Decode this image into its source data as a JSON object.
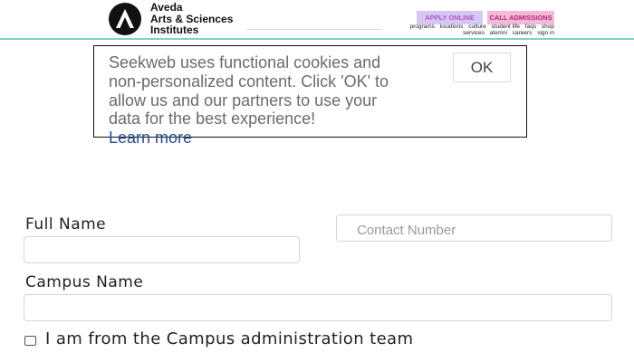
{
  "header": {
    "logo_lines": [
      "Aveda",
      "Arts & Sciences",
      "Institutes"
    ],
    "apply_online": "APPLY ONLINE",
    "call_admissions": "CALL ADMISSIONS",
    "nav_row1": [
      "programs",
      "locations",
      "culture",
      "student life",
      "faqs",
      "shop"
    ],
    "nav_row2": [
      "services",
      "alumni",
      "careers",
      "sign in"
    ]
  },
  "cookie": {
    "text": "Seekweb uses functional cookies and non-personalized content. Click 'OK' to allow us and our partners to use your data for the best experience!",
    "learn_more": "Learn more",
    "ok_label": "OK"
  },
  "form": {
    "full_name_label": "Full Name",
    "contact_number_placeholder": "Contact Number",
    "campus_name_label": "Campus Name",
    "admin_checkbox_label": "I am from the Campus administration team"
  },
  "colors": {
    "header_line": "#7fd0c4",
    "apply_bg": "#d5c6f5",
    "call_bg": "#f4b9d6",
    "link": "#2a4d8f"
  }
}
